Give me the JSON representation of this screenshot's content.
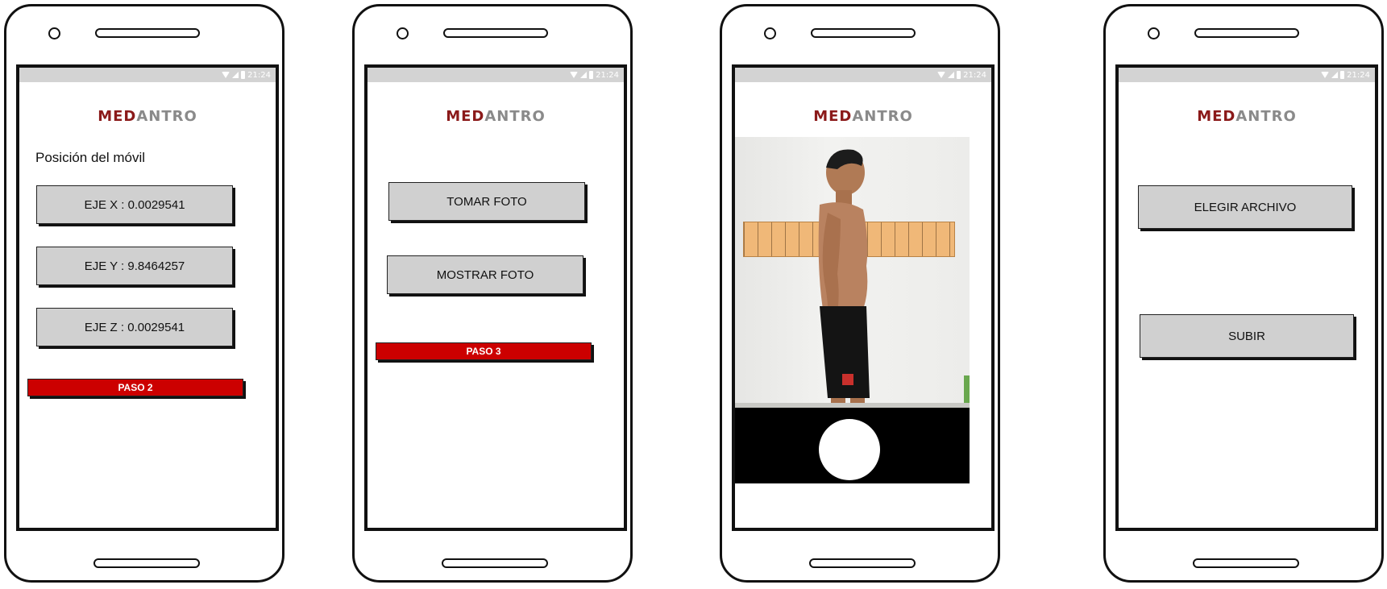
{
  "app": {
    "logo_left": "MED",
    "logo_right": "ANTRO",
    "status_time": "21:24",
    "brand_color": "#8b1a1a",
    "step_color": "#cc0000"
  },
  "screens": [
    {
      "title": "Posición del móvil",
      "buttons": [
        "EJE X : 0.0029541",
        "EJE Y : 9.8464257",
        "EJE Z : 0.0029541"
      ],
      "step": "PASO 2"
    },
    {
      "buttons": [
        "TOMAR FOTO",
        "MOSTRAR FOTO"
      ],
      "step": "PASO 3"
    },
    {
      "camera_preview": "person-standing-profile-photo",
      "shutter_icon": "shutter-button-icon"
    },
    {
      "buttons": [
        "ELEGIR ARCHIVO",
        "SUBIR"
      ]
    }
  ]
}
